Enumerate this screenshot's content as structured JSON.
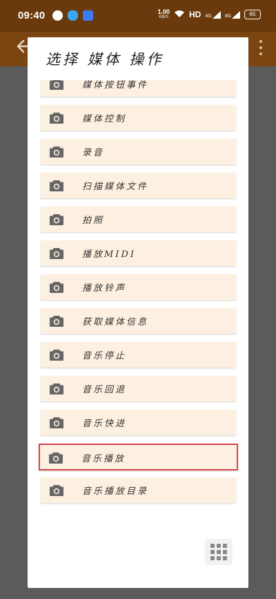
{
  "status_bar": {
    "time": "09:40",
    "net_speed_value": "1.00",
    "net_speed_unit": "KB/S",
    "hd_label": "HD",
    "signal_1": "4G",
    "signal_2": "4G",
    "battery": "65"
  },
  "dialog": {
    "title": "选择 媒体 操作",
    "items": [
      {
        "label": "媒体按钮事件",
        "icon": "camera-icon",
        "selected": false
      },
      {
        "label": "媒体控制",
        "icon": "camera-icon",
        "selected": false
      },
      {
        "label": "录音",
        "icon": "camera-icon",
        "selected": false
      },
      {
        "label": "扫描媒体文件",
        "icon": "camera-icon",
        "selected": false
      },
      {
        "label": "拍照",
        "icon": "camera-icon",
        "selected": false
      },
      {
        "label": "播放MIDI",
        "icon": "camera-icon",
        "selected": false
      },
      {
        "label": "播放铃声",
        "icon": "camera-icon",
        "selected": false
      },
      {
        "label": "获取媒体信息",
        "icon": "camera-icon",
        "selected": false
      },
      {
        "label": "音乐停止",
        "icon": "camera-icon",
        "selected": false
      },
      {
        "label": "音乐回退",
        "icon": "camera-icon",
        "selected": false
      },
      {
        "label": "音乐快进",
        "icon": "camera-icon",
        "selected": false
      },
      {
        "label": "音乐播放",
        "icon": "camera-icon",
        "selected": true
      },
      {
        "label": "音乐播放目录",
        "icon": "camera-icon",
        "selected": false
      }
    ]
  },
  "colors": {
    "status_bar_bg": "#6a3a0c",
    "app_bar_bg": "#7a4510",
    "item_bg": "#fdf0e0",
    "selected_border": "#d9434b",
    "icon": "#666666"
  }
}
